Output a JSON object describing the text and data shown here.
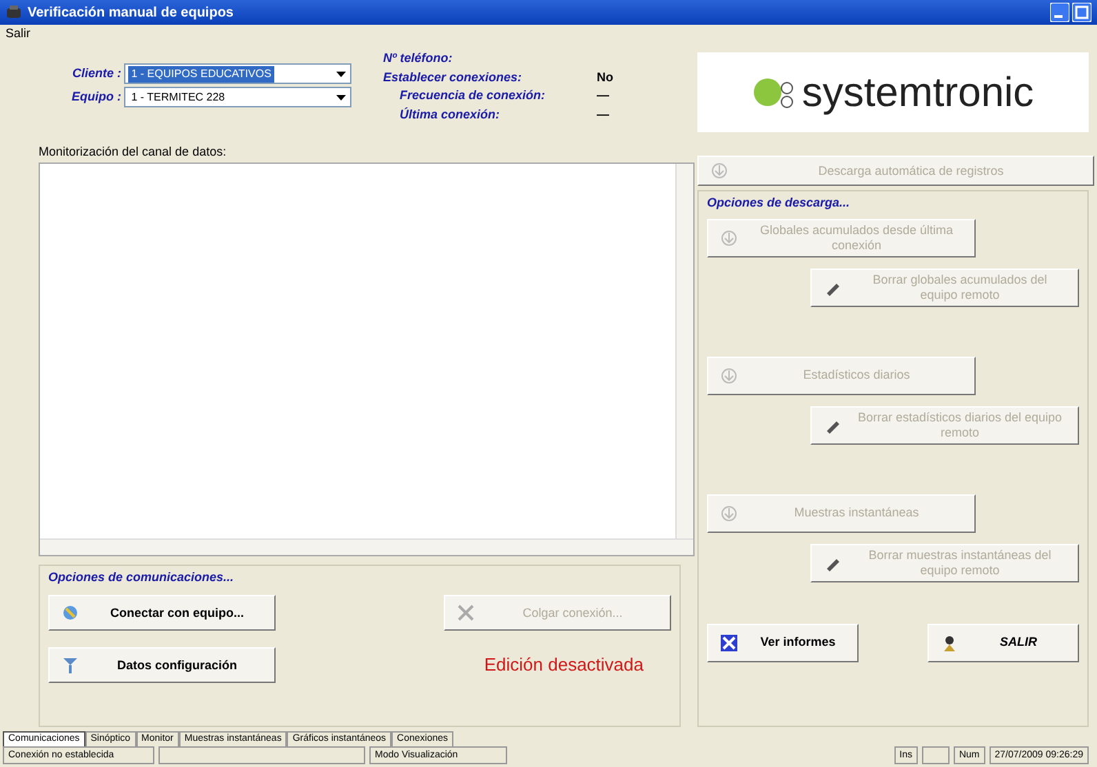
{
  "window": {
    "title": "Verificación manual de equipos"
  },
  "menu": [
    "Salir"
  ],
  "selectors": [
    {
      "label": "Cliente :",
      "value": "1 - EQUIPOS EDUCATIVOS",
      "highlighted": true
    },
    {
      "label": "Equipo :",
      "value": "1 - TERMITEC 228",
      "highlighted": false
    }
  ],
  "info": [
    {
      "label": "Nº teléfono:"
    },
    {
      "label": "Establecer conexiones:",
      "value": "No"
    },
    {
      "label": "Frecuencia de conexión:",
      "value": "—"
    },
    {
      "label": "Última conexión:",
      "value": "—"
    }
  ],
  "logo": {
    "text": "systemtronic"
  },
  "monitor": {
    "label": "Monitorización del canal de datos:"
  },
  "auto_download": {
    "label": "Descarga automática de registros",
    "disabled": true
  },
  "download_options": {
    "title": "Opciones de descarga...",
    "buttons": [
      {
        "label": "Globales acumulados desde última conexión",
        "kind": "fetch",
        "disabled": true
      },
      {
        "label": "Borrar globales acumulados del equipo remoto",
        "kind": "erase",
        "disabled": true
      },
      {
        "label": "Estadísticos diarios",
        "kind": "fetch",
        "disabled": true
      },
      {
        "label": "Borrar estadísticos diarios del equipo remoto",
        "kind": "erase",
        "disabled": true
      },
      {
        "label": "Muestras instantáneas",
        "kind": "fetch",
        "disabled": true
      },
      {
        "label": "Borrar muestras instantáneas del equipo remoto",
        "kind": "erase",
        "disabled": true
      }
    ]
  },
  "comm_options": {
    "title": "Opciones de comunicaciones...",
    "buttons": [
      {
        "label": "Conectar con equipo...",
        "kind": "connect",
        "disabled": false
      },
      {
        "label": "Colgar conexión...",
        "kind": "hangup",
        "disabled": true
      },
      {
        "label": "Datos configuración",
        "kind": "config",
        "disabled": false
      }
    ],
    "edit_status": "Edición desactivada"
  },
  "actions": [
    {
      "label": "Ver informes",
      "kind": "reports"
    },
    {
      "label": "SALIR",
      "kind": "exit"
    }
  ],
  "tabs": [
    {
      "label": "Comunicaciones",
      "selected": true
    },
    {
      "label": "Sinóptico",
      "selected": false
    },
    {
      "label": "Monitor",
      "selected": false
    },
    {
      "label": "Muestras instantáneas",
      "selected": false
    },
    {
      "label": "Gráficos instantáneos",
      "selected": false
    },
    {
      "label": "Conexiones",
      "selected": false
    }
  ],
  "status_bar": [
    "Conexión no establecida",
    "Modo Visualización",
    "Ins",
    "Num",
    "27/07/2009 09:26:29"
  ]
}
